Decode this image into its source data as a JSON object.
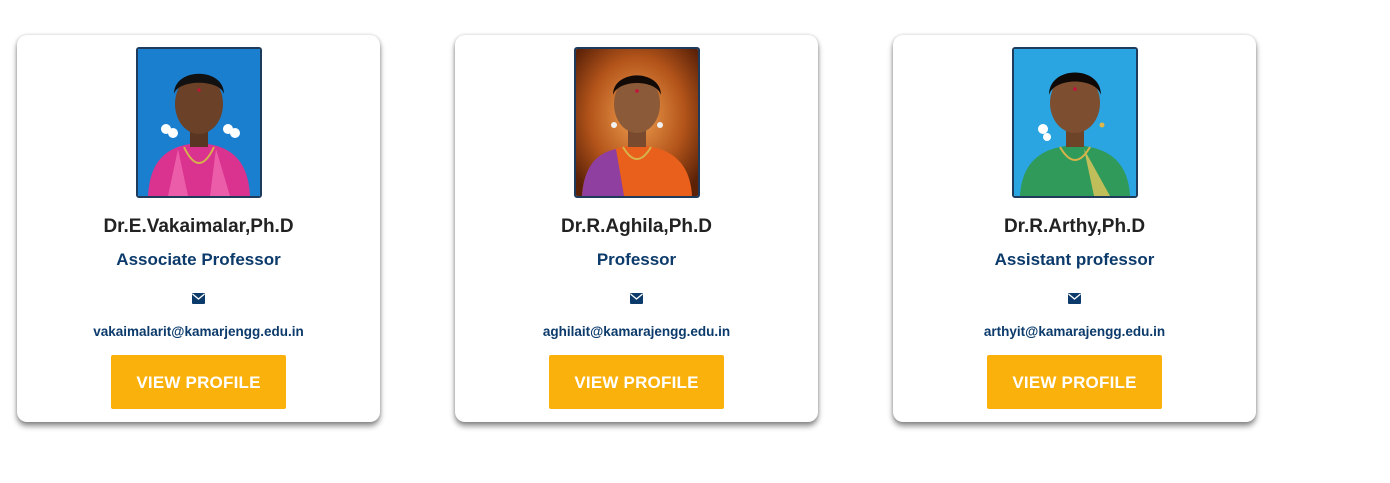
{
  "faculty": [
    {
      "name": "Dr.E.Vakaimalar,Ph.D",
      "designation": "Associate Professor",
      "email": "vakaimalarit@kamarjengg.edu.in",
      "button_label": "VIEW PROFILE",
      "photo_alt": "Dr.E.Vakaimalar,Ph.D",
      "photo_bg": "#1b7fd0",
      "saree_color": "#d9338f"
    },
    {
      "name": "Dr.R.Aghila,Ph.D",
      "designation": "Professor",
      "email": "aghilait@kamarajengg.edu.in",
      "button_label": "VIEW PROFILE",
      "photo_alt": "Dr.R.Aghila,Ph.D",
      "photo_bg": "#8a3a0c",
      "saree_color": "#e8601c"
    },
    {
      "name": "Dr.R.Arthy,Ph.D",
      "designation": "Assistant professor",
      "email": "arthyit@kamarajengg.edu.in",
      "button_label": "VIEW PROFILE",
      "photo_alt": "Dr.R.Arthy,Ph.D",
      "photo_bg": "#2aa5e2",
      "saree_color": "#2f9a5a"
    }
  ],
  "icons": {
    "mail": "envelope-icon"
  },
  "colors": {
    "name_text": "#222222",
    "accent_text": "#0b3a6b",
    "button_bg": "#fbb10b",
    "button_text": "#ffffff"
  }
}
